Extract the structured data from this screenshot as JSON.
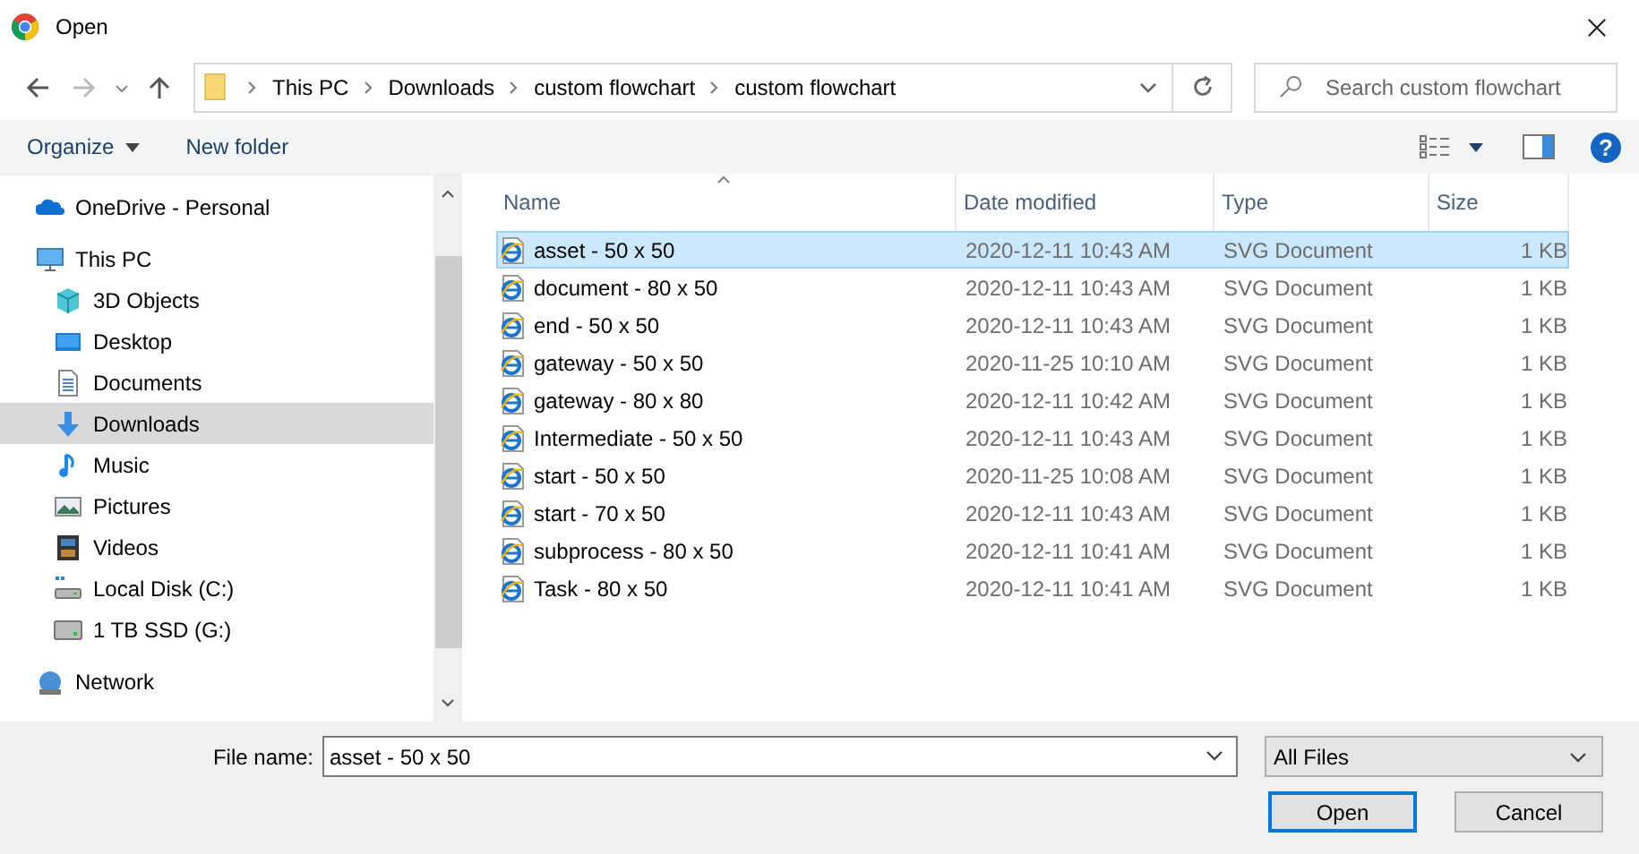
{
  "window": {
    "title": "Open"
  },
  "address_bar": {
    "path": [
      "This PC",
      "Downloads",
      "custom flowchart",
      "custom flowchart"
    ]
  },
  "search": {
    "placeholder": "Search custom flowchart"
  },
  "toolbar": {
    "organize": "Organize",
    "new_folder": "New folder",
    "help": "?"
  },
  "sidebar": {
    "items": [
      {
        "label": "OneDrive - Personal",
        "kind": "cloud",
        "selected": false
      },
      {
        "label": "This PC",
        "kind": "pc",
        "selected": false,
        "children": [
          {
            "label": "3D Objects",
            "kind": "cube",
            "selected": false
          },
          {
            "label": "Desktop",
            "kind": "desktop",
            "selected": false
          },
          {
            "label": "Documents",
            "kind": "documents",
            "selected": false
          },
          {
            "label": "Downloads",
            "kind": "downloads",
            "selected": true
          },
          {
            "label": "Music",
            "kind": "music",
            "selected": false
          },
          {
            "label": "Pictures",
            "kind": "pictures",
            "selected": false
          },
          {
            "label": "Videos",
            "kind": "videos",
            "selected": false
          },
          {
            "label": "Local Disk (C:)",
            "kind": "system-drive",
            "selected": false
          },
          {
            "label": "1 TB SSD (G:)",
            "kind": "drive",
            "selected": false
          }
        ]
      },
      {
        "label": "Network",
        "kind": "network",
        "selected": false
      }
    ]
  },
  "columns": [
    "Name",
    "Date modified",
    "Type",
    "Size"
  ],
  "files": [
    {
      "name": "asset - 50 x 50",
      "date": "2020-12-11 10:43 AM",
      "type": "SVG Document",
      "size": "1 KB",
      "selected": true
    },
    {
      "name": "document - 80 x 50",
      "date": "2020-12-11 10:43 AM",
      "type": "SVG Document",
      "size": "1 KB",
      "selected": false
    },
    {
      "name": "end - 50 x 50",
      "date": "2020-12-11 10:43 AM",
      "type": "SVG Document",
      "size": "1 KB",
      "selected": false
    },
    {
      "name": "gateway - 50 x 50",
      "date": "2020-11-25 10:10 AM",
      "type": "SVG Document",
      "size": "1 KB",
      "selected": false
    },
    {
      "name": "gateway - 80 x 80",
      "date": "2020-12-11 10:42 AM",
      "type": "SVG Document",
      "size": "1 KB",
      "selected": false
    },
    {
      "name": "Intermediate - 50 x 50",
      "date": "2020-12-11 10:43 AM",
      "type": "SVG Document",
      "size": "1 KB",
      "selected": false
    },
    {
      "name": "start - 50 x 50",
      "date": "2020-11-25 10:08 AM",
      "type": "SVG Document",
      "size": "1 KB",
      "selected": false
    },
    {
      "name": "start - 70 x 50",
      "date": "2020-12-11 10:43 AM",
      "type": "SVG Document",
      "size": "1 KB",
      "selected": false
    },
    {
      "name": "subprocess - 80 x 50",
      "date": "2020-12-11 10:41 AM",
      "type": "SVG Document",
      "size": "1 KB",
      "selected": false
    },
    {
      "name": "Task - 80 x 50",
      "date": "2020-12-11 10:41 AM",
      "type": "SVG Document",
      "size": "1 KB",
      "selected": false
    }
  ],
  "file_name": {
    "label": "File name:",
    "value": "asset - 50 x 50"
  },
  "file_type": {
    "value": "All Files"
  },
  "buttons": [
    {
      "label": "Open",
      "default": true
    },
    {
      "label": "Cancel",
      "default": false
    }
  ]
}
